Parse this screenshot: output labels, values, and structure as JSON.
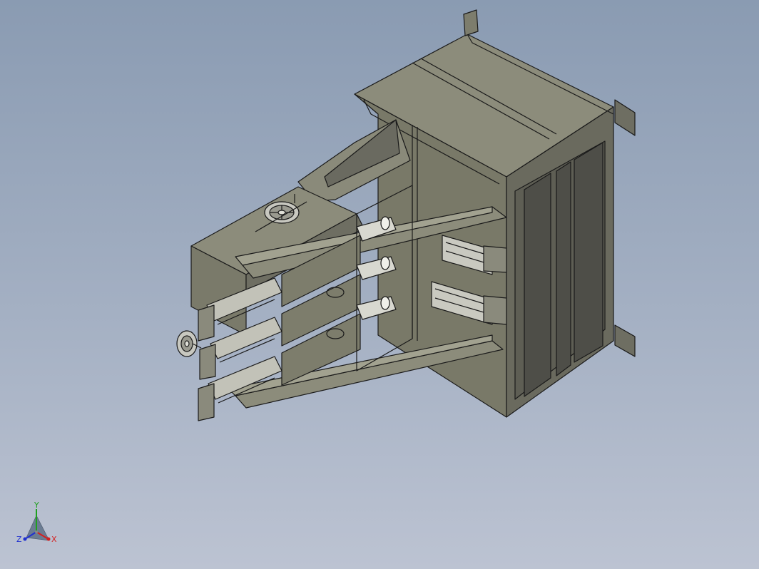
{
  "viewport": {
    "background_top": "#8a9bb2",
    "background_bottom": "#bcc3d2",
    "model_line_color": "#1a1a1a",
    "model_face_light": "#898978",
    "model_face_mid": "#76766a",
    "model_face_dark": "#55554f"
  },
  "triad": {
    "x_label": "X",
    "y_label": "Y",
    "z_label": "Z",
    "x_color": "#d42020",
    "y_color": "#1fa01f",
    "z_color": "#2030d0"
  }
}
